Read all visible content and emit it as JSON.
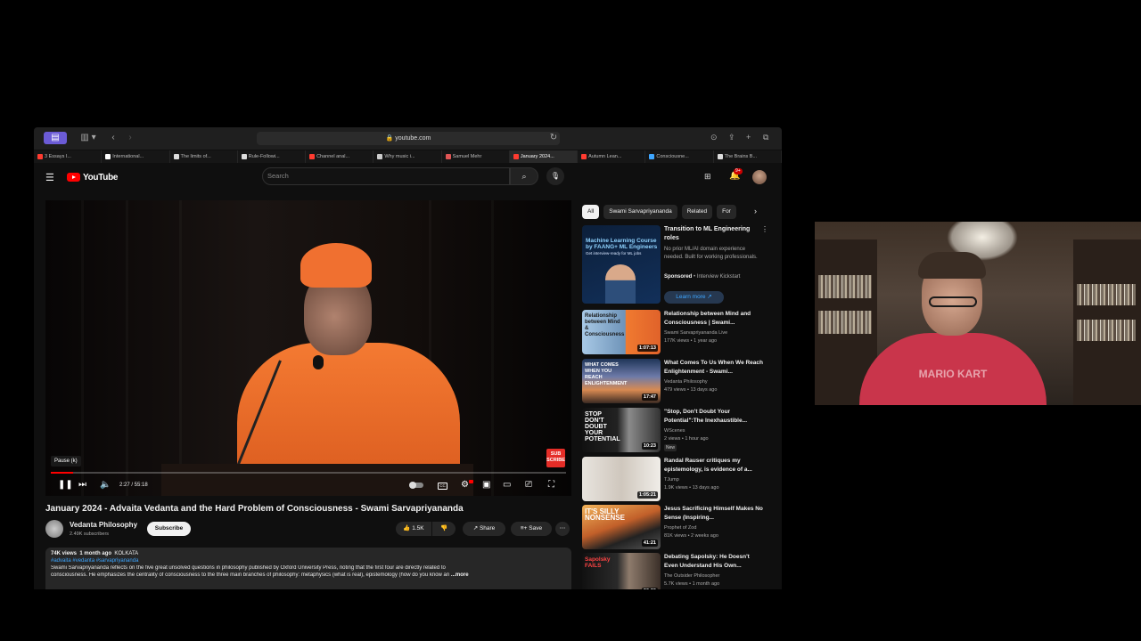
{
  "browser": {
    "url": "youtube.com",
    "tabs": [
      {
        "label": "3 Essays I...",
        "color": "#ff3b30",
        "active": false
      },
      {
        "label": "International...",
        "color": "#ffffff",
        "active": false
      },
      {
        "label": "The limits of...",
        "color": "#dddddd",
        "active": false
      },
      {
        "label": "Rule-Followi...",
        "color": "#dddddd",
        "active": false
      },
      {
        "label": "Channel anal...",
        "color": "#ff3b30",
        "active": false
      },
      {
        "label": "Why music i...",
        "color": "#cccccc",
        "active": false
      },
      {
        "label": "Samuel Mehr",
        "color": "#e05555",
        "active": false
      },
      {
        "label": "January 2024...",
        "color": "#ff3b30",
        "active": true
      },
      {
        "label": "Autumn Lean...",
        "color": "#ff3b30",
        "active": false
      },
      {
        "label": "Consciousne...",
        "color": "#3ea6ff",
        "active": false
      },
      {
        "label": "The Brains B...",
        "color": "#dddddd",
        "active": false
      }
    ]
  },
  "header": {
    "logo_text": "YouTube",
    "search_placeholder": "Search",
    "notification_count": "9+"
  },
  "player": {
    "tooltip": "Pause (k)",
    "time": "2:27 / 55:18",
    "progress": 0.044,
    "watermark": "SUB SCRIBE"
  },
  "video": {
    "title": "January 2024 - Advaita Vedanta and the Hard Problem of Consciousness - Swami Sarvapriyananda",
    "channel": "Vedanta Philosophy",
    "subscribers": "2.49K subscribers",
    "subscribe_label": "Subscribe",
    "likes": "1.5K",
    "share_label": "Share",
    "save_label": "Save"
  },
  "description": {
    "views": "74K views",
    "date": "1 month ago",
    "location": "KOLKATA",
    "tags": "#advaita #vedanta #sarvapriyananda",
    "line1": "Swami Sarvapriyananda reflects on the five great unsolved questions in philosophy published by Oxford University Press, noting that the first four are directly related to",
    "line2": "consciousness. He emphasizes the centrality of consciousness to the three main branches of philosophy: metaphysics (what is real), epistemology (how do you know an",
    "more": "...more"
  },
  "chips": [
    "All",
    "Swami Sarvapriyananda",
    "Related",
    "For"
  ],
  "ad": {
    "thumb_title": "Machine Learning Course by FAANG+ ML Engineers",
    "thumb_sub": "Get interview-ready for ML jobs",
    "title": "Transition to ML Engineering roles",
    "desc": "No prior ML/AI domain experience needed. Built for working professionals.",
    "sponsored": "Sponsored",
    "advertiser": "Interview Kickstart",
    "cta": "Learn more"
  },
  "recommendations": [
    {
      "title": "Relationship between Mind and Consciousness | Swami...",
      "channel": "Swami Sarvapriyananda Live",
      "meta": "177K views • 1 year ago",
      "duration": "1:07:13",
      "thumb_text": "Relationship between Mind & Consciousness",
      "badge": ""
    },
    {
      "title": "What Comes To Us When We Reach Enlightenment - Swami...",
      "channel": "Vedanta Philosophy",
      "meta": "479 views • 13 days ago",
      "duration": "17:47",
      "thumb_text": "WHAT COMES WHEN YOU REACH ENLIGHTENMENT",
      "badge": ""
    },
    {
      "title": "\"Stop, Don't Doubt Your Potential\":The Inexhaustible...",
      "channel": "WScenes",
      "meta": "2 views • 1 hour ago",
      "duration": "10:23",
      "thumb_text": "STOP DON'T DOUBT YOUR POTENTIAL",
      "badge": "New"
    },
    {
      "title": "Randal Rauser critiques my epistemology, is evidence of a...",
      "channel": "TJump",
      "meta": "1.9K views • 13 days ago",
      "duration": "1:05:21",
      "thumb_text": "",
      "badge": ""
    },
    {
      "title": "Jesus Sacrificing Himself Makes No Sense (Inspiring...",
      "channel": "Prophet of Zod",
      "meta": "81K views • 2 weeks ago",
      "duration": "41:21",
      "thumb_text": "IT'S SILLY NONSENSE",
      "badge": ""
    },
    {
      "title": "Debating Sapolsky: He Doesn't Even Understand His Own...",
      "channel": "The Outsider Philosopher",
      "meta": "5.7K views • 1 month ago",
      "duration": "20:26",
      "thumb_text": "Sapolsky FAILS",
      "badge": ""
    }
  ],
  "webcam": {
    "shirt_text": "MARIO KART"
  }
}
